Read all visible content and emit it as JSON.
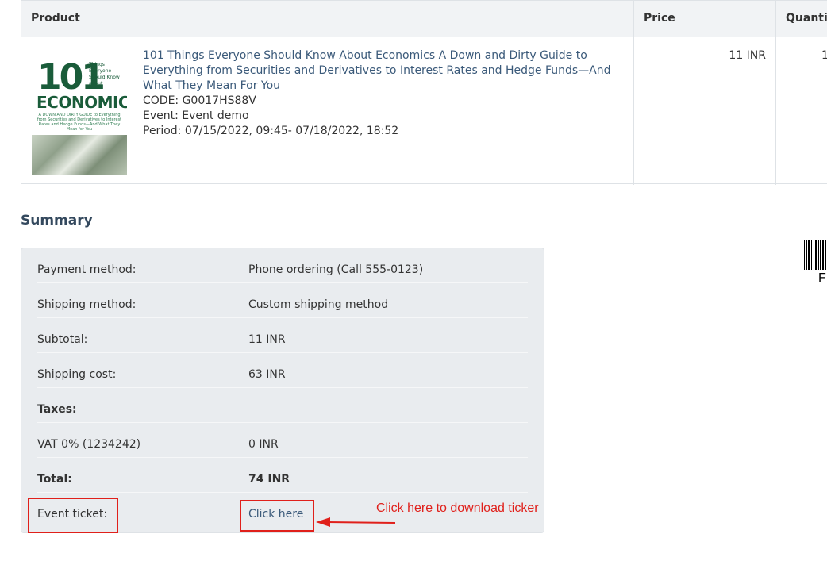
{
  "table": {
    "headers": {
      "product": "Product",
      "price": "Price",
      "quantity": "Quantit"
    },
    "item": {
      "name": "101 Things Everyone Should Know About Economics A Down and Dirty Guide to Everything from Securities and Derivatives to Interest Rates and Hedge Funds—And What They Mean For You",
      "code": "CODE: G0017HS88V",
      "event": "Event: Event demo",
      "period": "Period:  07/15/2022, 09:45- 07/18/2022, 18:52",
      "price": "11 INR",
      "quantity": "1",
      "thumbnail": {
        "number": "101",
        "small": "Things Everyone Should Know about",
        "title": "ECONOMICS",
        "subtitle": "A DOWN AND DIRTY GUIDE to Everything from Securities and Derivatives to Interest Rates and Hedge Funds—And What They Mean for You"
      }
    }
  },
  "summary": {
    "title": "Summary",
    "rows": [
      {
        "label": "Payment method:",
        "value": "Phone ordering (Call 555-0123)"
      },
      {
        "label": "Shipping method:",
        "value": "Custom shipping method"
      },
      {
        "label": "Subtotal:",
        "value": "11 INR"
      },
      {
        "label": "Shipping cost:",
        "value": "63 INR"
      },
      {
        "label": "Taxes:",
        "value": ""
      },
      {
        "label": "VAT 0% (1234242)",
        "value": "0 INR"
      },
      {
        "label": "Total:",
        "value": "74 INR"
      },
      {
        "label": "Event ticket:",
        "value": "Click here"
      }
    ]
  },
  "annotation": {
    "text": "Click here to download ticker",
    "color": "#e0201b"
  },
  "barcode": {
    "text": "F"
  }
}
